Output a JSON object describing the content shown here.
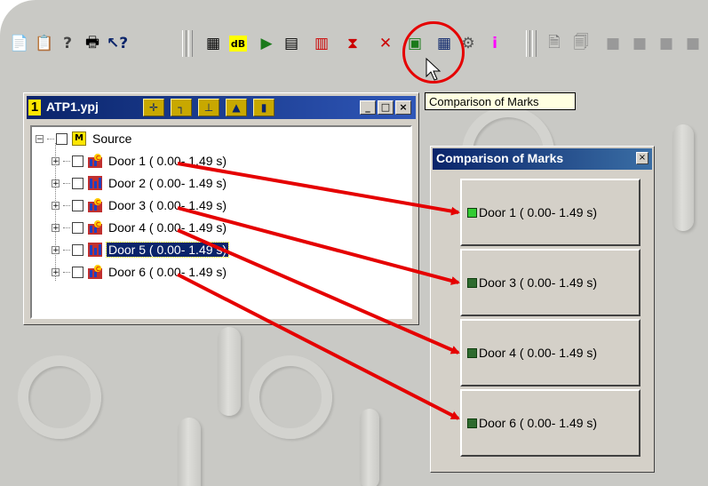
{
  "project_window": {
    "number": "1",
    "title": "ATP1.ypj",
    "window_buttons": [
      "_",
      "□",
      "×"
    ],
    "tree": {
      "root_label": "Source",
      "root_badge": "M",
      "items": [
        {
          "label": "Door 1 ( 0.00- 1.49 s)",
          "icon": "marked-signal-icon",
          "selected": false
        },
        {
          "label": "Door 2 ( 0.00- 1.49 s)",
          "icon": "signal-icon",
          "selected": false
        },
        {
          "label": "Door 3 ( 0.00- 1.49 s)",
          "icon": "marked-signal-icon",
          "selected": false
        },
        {
          "label": "Door 4 ( 0.00- 1.49 s)",
          "icon": "marked-signal-icon",
          "selected": false
        },
        {
          "label": "Door 5 ( 0.00- 1.49 s)",
          "icon": "signal-icon",
          "selected": true
        },
        {
          "label": "Door 6 ( 0.00- 1.49 s)",
          "icon": "marked-signal-icon",
          "selected": false
        }
      ]
    }
  },
  "tooltip": {
    "text": "Comparison of Marks"
  },
  "comparison_window": {
    "title": "Comparison of Marks",
    "close": "×",
    "items": [
      {
        "label": "Door 1 ( 0.00- 1.49 s)",
        "swatch": "#33cc33",
        "active": true
      },
      {
        "label": "Door 3 ( 0.00- 1.49 s)",
        "swatch": "#2e6b2e",
        "active": false
      },
      {
        "label": "Door 4 ( 0.00- 1.49 s)",
        "swatch": "#2e6b2e",
        "active": false
      },
      {
        "label": "Door 6 ( 0.00- 1.49 s)",
        "swatch": "#2e6b2e",
        "active": false
      }
    ]
  },
  "colors": {
    "annotation_red": "#e50000",
    "title_bar": "#0a246a",
    "selection": "#0a246a"
  }
}
